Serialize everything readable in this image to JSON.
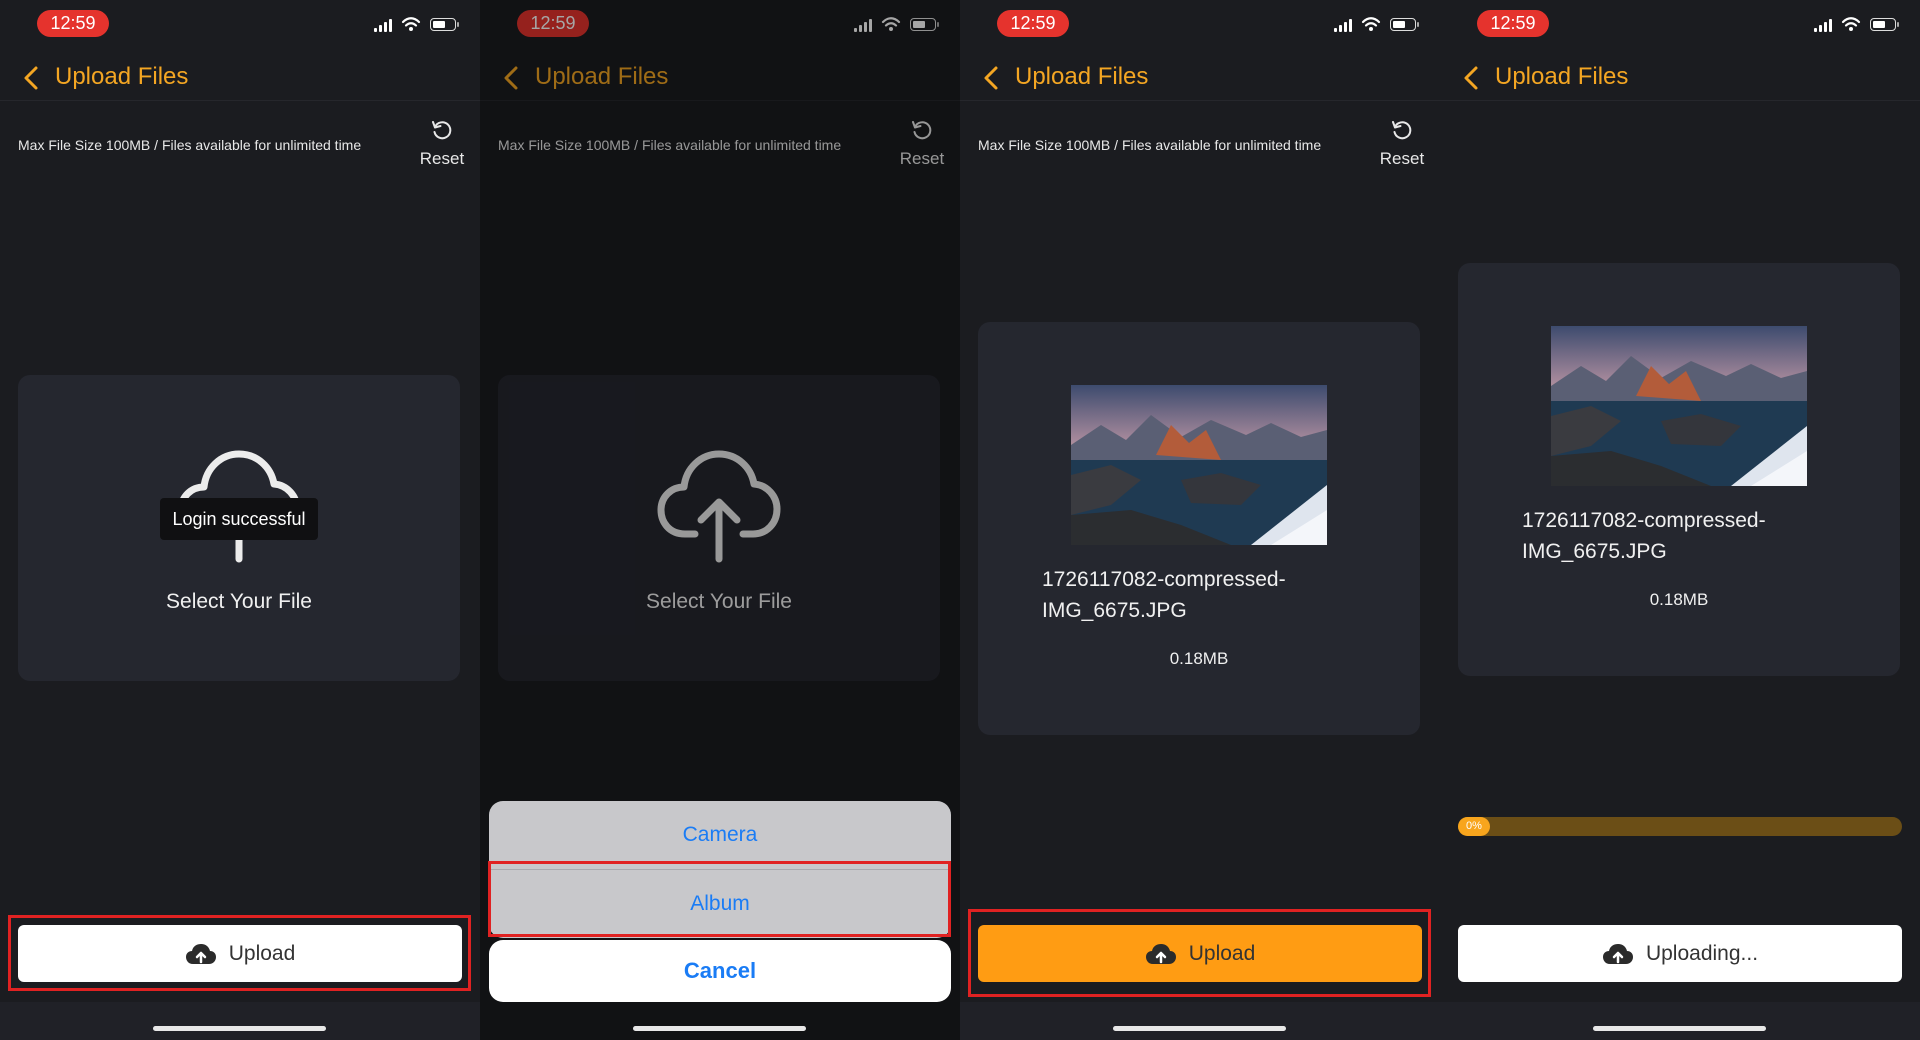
{
  "status": {
    "time": "12:59"
  },
  "header": {
    "title": "Upload Files"
  },
  "info": {
    "text": "Max File Size 100MB / Files available for unlimited time",
    "reset_label": "Reset"
  },
  "select_label": "Select Your File",
  "toast": "Login successful",
  "file": {
    "name_line1": "1726117082-compressed-",
    "name_line2": "IMG_6675.JPG",
    "size": "0.18MB"
  },
  "buttons": {
    "upload": "Upload",
    "uploading": "Uploading..."
  },
  "action_sheet": {
    "camera": "Camera",
    "album": "Album",
    "cancel": "Cancel"
  },
  "progress": {
    "percent_label": "0%",
    "value": 0
  },
  "colors": {
    "accent": "#f4a623",
    "upload_orange": "#ff9c13",
    "highlight_red": "#e02222",
    "link_blue": "#1a7cf5"
  }
}
